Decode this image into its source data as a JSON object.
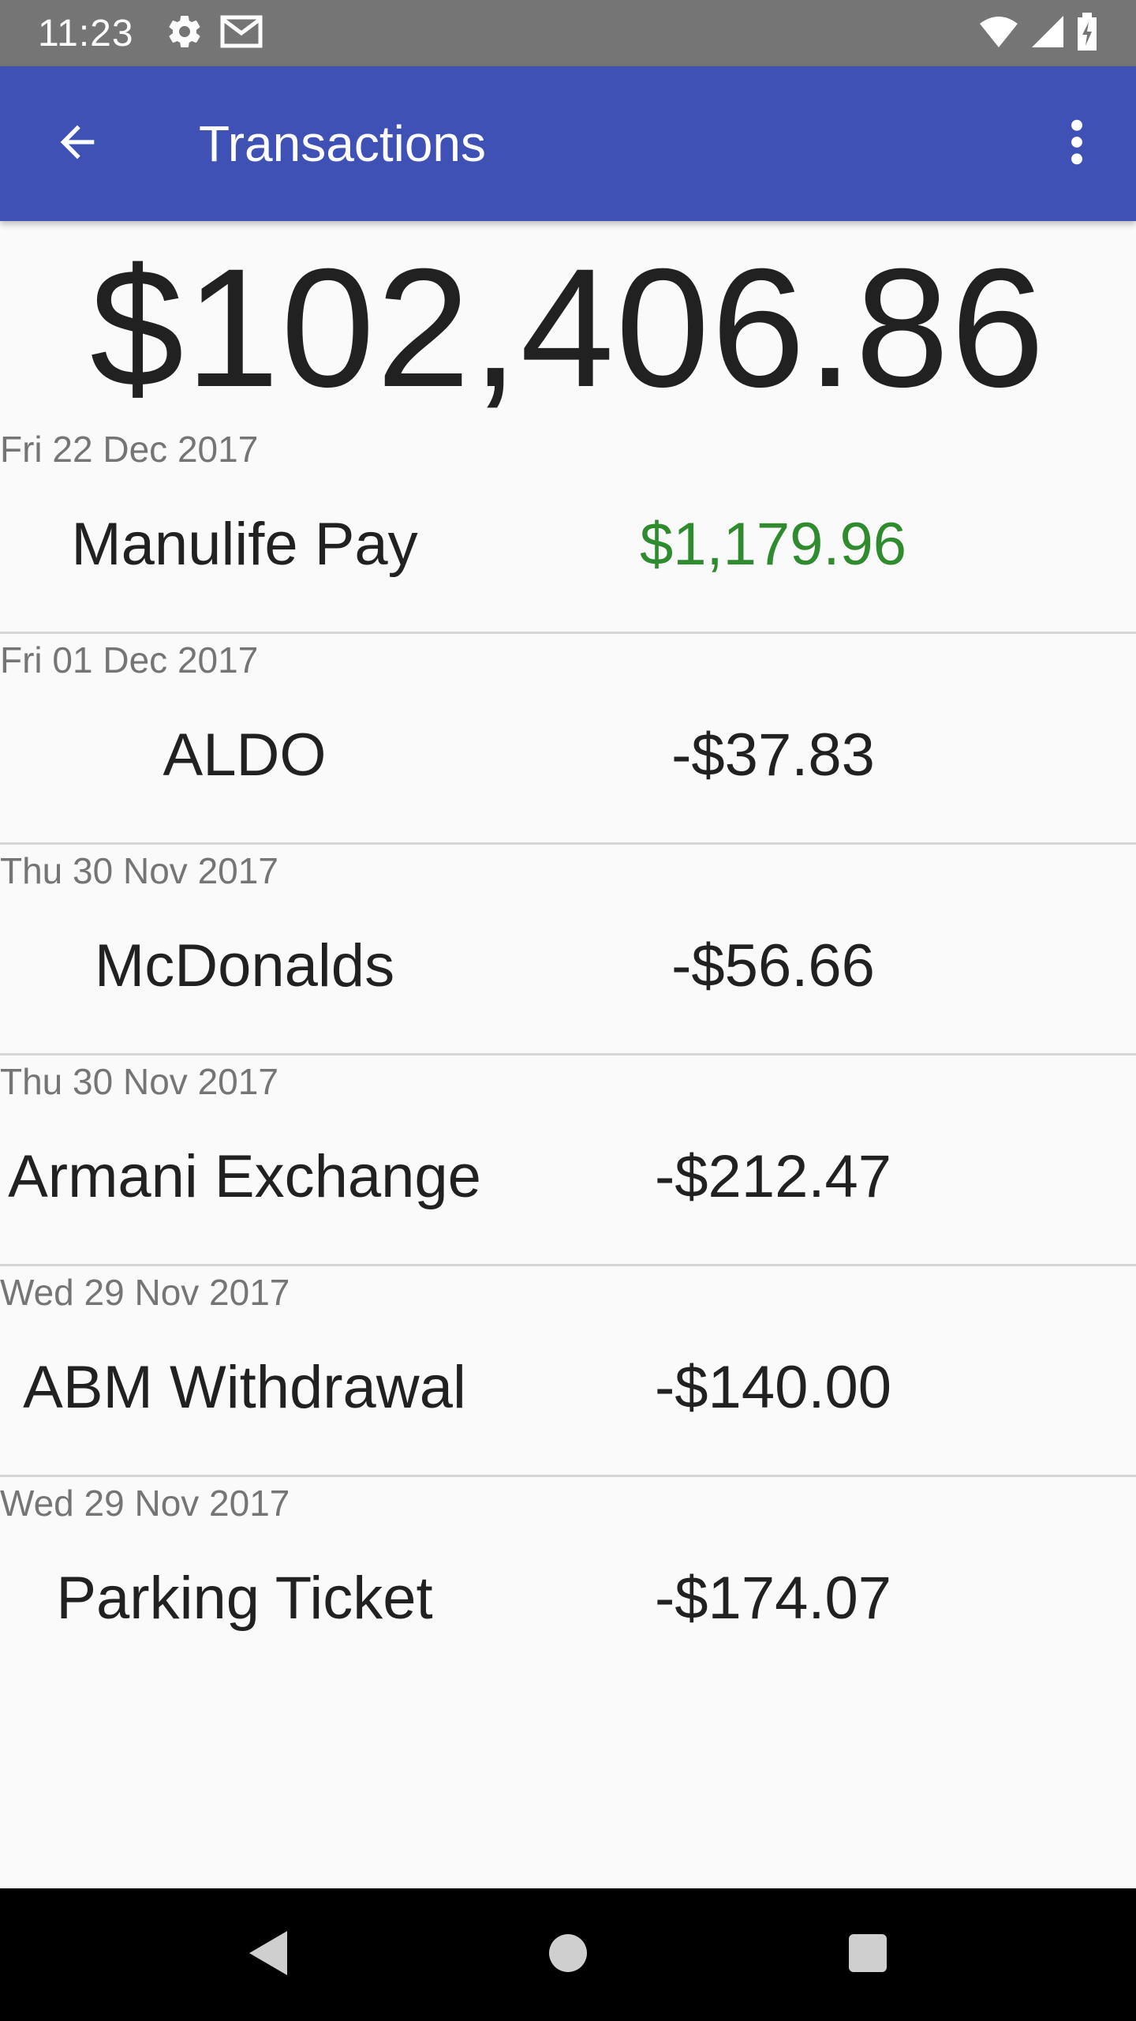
{
  "status_bar": {
    "time": "11:23",
    "icons": [
      "gear-icon",
      "gmail-icon",
      "wifi-icon",
      "signal-icon",
      "battery-charging-icon"
    ]
  },
  "app_bar": {
    "title": "Transactions",
    "back_icon": "arrow-back-icon",
    "menu_icon": "more-vert-icon",
    "color": "#3f51b5"
  },
  "balance": "$102,406.86",
  "transactions": [
    {
      "date": "Fri 22 Dec 2017",
      "name": "Manulife Pay",
      "amount": "$1,179.96",
      "type": "credit"
    },
    {
      "date": "Fri 01 Dec 2017",
      "name": "ALDO",
      "amount": "-$37.83",
      "type": "debit"
    },
    {
      "date": "Thu 30 Nov 2017",
      "name": "McDonalds",
      "amount": "-$56.66",
      "type": "debit"
    },
    {
      "date": "Thu 30 Nov 2017",
      "name": "Armani Exchange",
      "amount": "-$212.47",
      "type": "debit"
    },
    {
      "date": "Wed 29 Nov 2017",
      "name": "ABM Withdrawal",
      "amount": "-$140.00",
      "type": "debit"
    },
    {
      "date": "Wed 29 Nov 2017",
      "name": "Parking Ticket",
      "amount": "-$174.07",
      "type": "debit"
    }
  ],
  "colors": {
    "credit": "#2e8b2e",
    "debit": "#212121"
  },
  "nav_bar": {
    "buttons": [
      "back-triangle-icon",
      "home-circle-icon",
      "recents-square-icon"
    ]
  }
}
